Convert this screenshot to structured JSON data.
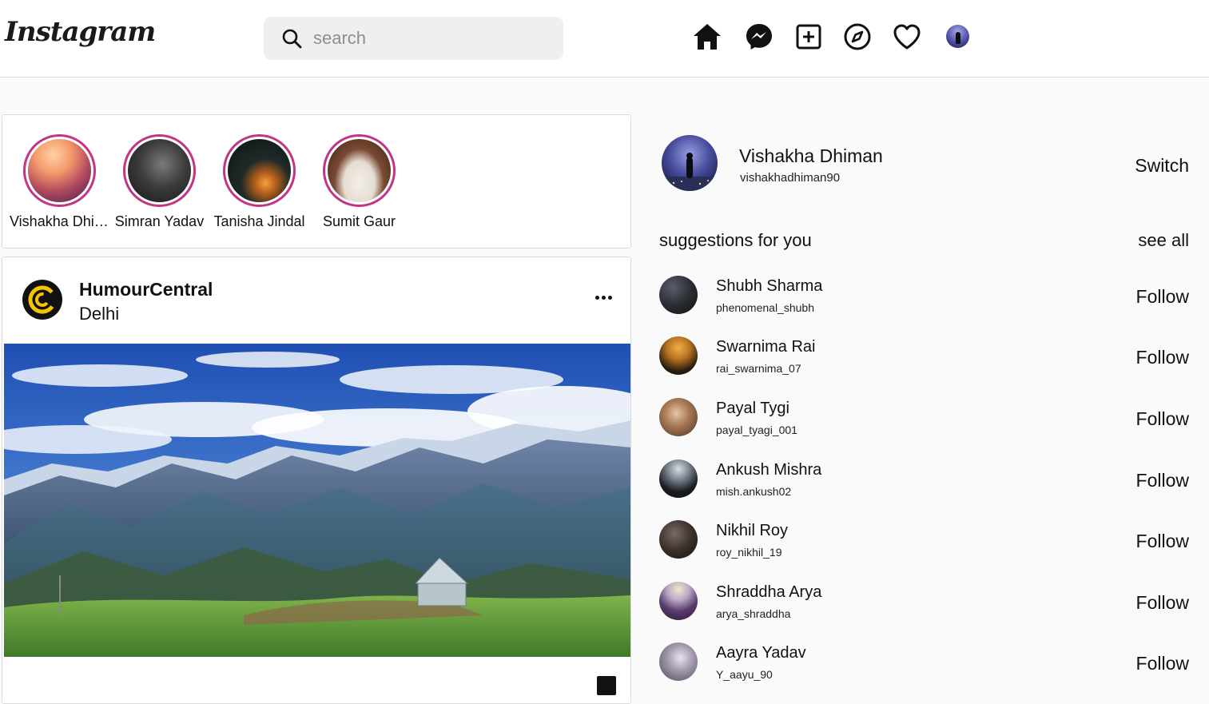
{
  "header": {
    "logo": "Instagram",
    "search": {
      "placeholder": "search"
    },
    "nav_icons": [
      "home-icon",
      "messenger-icon",
      "new-post-icon",
      "explore-icon",
      "heart-icon",
      "profile-avatar"
    ]
  },
  "stories": [
    {
      "name": "Vishakha Dhiman"
    },
    {
      "name": "Simran Yadav"
    },
    {
      "name": "Tanisha Jindal"
    },
    {
      "name": "Sumit Gaur"
    }
  ],
  "post": {
    "username": "HumourCentral",
    "location": "Delhi"
  },
  "profile": {
    "name": "Vishakha Dhiman",
    "handle": "vishakhadhiman90",
    "switch_label": "Switch"
  },
  "suggestions": {
    "title": "suggestions for you",
    "see_all": "see all",
    "follow_label": "Follow",
    "items": [
      {
        "name": "Shubh Sharma",
        "handle": "phenomenal_shubh"
      },
      {
        "name": "Swarnima Rai",
        "handle": "rai_swarnima_07"
      },
      {
        "name": "Payal Tygi",
        "handle": "payal_tyagi_001"
      },
      {
        "name": "Ankush Mishra",
        "handle": "mish.ankush02"
      },
      {
        "name": "Nikhil Roy",
        "handle": "roy_nikhil_19"
      },
      {
        "name": "Shraddha Arya",
        "handle": "arya_shraddha"
      },
      {
        "name": "Aayra Yadav",
        "handle": "Y_aayu_90"
      }
    ]
  },
  "colors": {
    "story_ring": "#c13584",
    "search_bg": "#efefef",
    "border": "#dbdbdb"
  }
}
